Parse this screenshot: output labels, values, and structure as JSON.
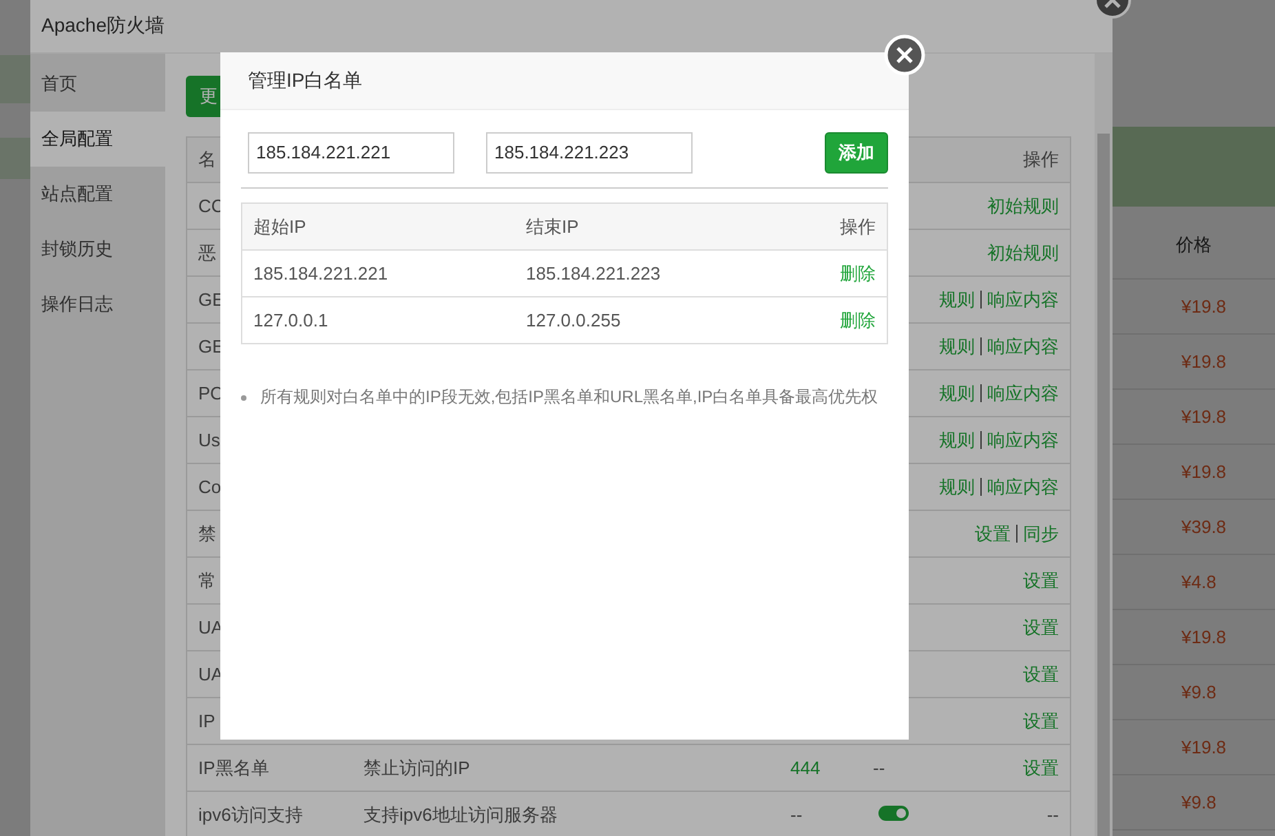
{
  "page_behind": {
    "price_header": "价格",
    "prices": [
      "¥19.8",
      "¥19.8",
      "¥19.8",
      "¥19.8",
      "¥39.8",
      "¥4.8",
      "¥19.8",
      "¥9.8",
      "¥19.8",
      "¥9.8"
    ]
  },
  "window": {
    "title": "Apache防火墙",
    "sidebar": [
      {
        "label": "首页",
        "selected": false
      },
      {
        "label": "全局配置",
        "selected": true
      },
      {
        "label": "站点配置",
        "selected": false
      },
      {
        "label": "封锁历史",
        "selected": false
      },
      {
        "label": "操作日志",
        "selected": false
      }
    ],
    "update_button": "更",
    "table": {
      "columns": [
        "名",
        "操作"
      ],
      "rows": [
        {
          "name": "CC",
          "actions": [
            "初始规则"
          ]
        },
        {
          "name": "恶",
          "actions": [
            "初始规则"
          ]
        },
        {
          "name": "GE",
          "actions": [
            "规则",
            "响应内容"
          ]
        },
        {
          "name": "GE",
          "actions": [
            "规则",
            "响应内容"
          ]
        },
        {
          "name": "PO",
          "actions": [
            "规则",
            "响应内容"
          ]
        },
        {
          "name": "Us",
          "actions": [
            "规则",
            "响应内容"
          ]
        },
        {
          "name": "Co",
          "actions": [
            "规则",
            "响应内容"
          ]
        },
        {
          "name": "禁",
          "actions": [
            "设置",
            "同步"
          ]
        },
        {
          "name": "常",
          "actions": [
            "设置"
          ]
        },
        {
          "name": "UA",
          "actions": [
            "设置"
          ]
        },
        {
          "name": "UA",
          "actions": [
            "设置"
          ]
        },
        {
          "name": "IP",
          "actions": [
            "设置"
          ]
        },
        {
          "name": "IP黑名单",
          "description": "禁止访问的IP",
          "count": "444",
          "status": "--",
          "actions": [
            "设置"
          ]
        },
        {
          "name": "ipv6访问支持",
          "description": "支持ipv6地址访问服务器",
          "count": "--",
          "toggle": {
            "on": true
          },
          "action_text": "--"
        }
      ]
    }
  },
  "modal": {
    "title": "管理IP白名单",
    "start_ip": "185.184.221.221",
    "end_ip": "185.184.221.223",
    "add_button": "添加",
    "columns": [
      "超始IP",
      "结束IP",
      "操作"
    ],
    "rows": [
      {
        "start": "185.184.221.221",
        "end": "185.184.221.223",
        "action": "删除"
      },
      {
        "start": "127.0.0.1",
        "end": "127.0.0.255",
        "action": "删除"
      }
    ],
    "note": "所有规则对白名单中的IP段无效,包括IP黑名单和URL黑名单,IP白名单具备最高优先权"
  }
}
